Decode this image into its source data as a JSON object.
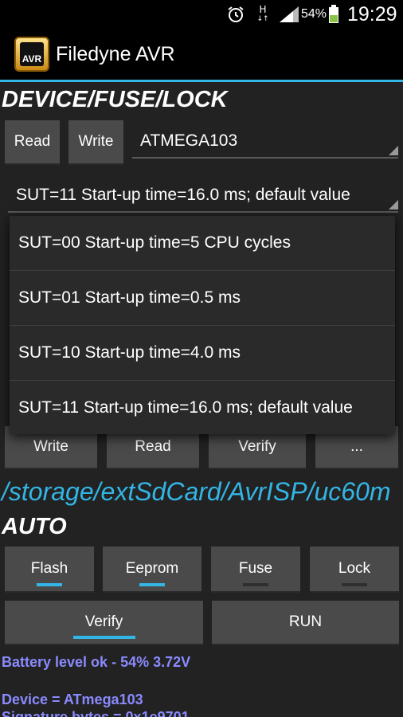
{
  "status_bar": {
    "icons": [
      "alarm-icon",
      "hspa-data-icon",
      "signal-icon",
      "battery-icon"
    ],
    "h_label": "H",
    "battery_percent": "54%",
    "time": "19:29"
  },
  "app_bar": {
    "title": "Filedyne AVR",
    "logo_text": "AVR",
    "accent_color": "#33b5e5"
  },
  "device_section": {
    "title": "DEVICE/FUSE/LOCK",
    "read_label": "Read",
    "write_label": "Write",
    "device_value": "ATMEGA103",
    "fuse_value": "SUT=11 Start-up time=16.0 ms; default value"
  },
  "file_section": {
    "buttons": [
      "Write",
      "Read",
      "Verify",
      "..."
    ],
    "path": "/storage/extSdCard/AvrISP/uc60m"
  },
  "auto_section": {
    "title": "AUTO",
    "toggles": [
      {
        "label": "Flash",
        "on": true
      },
      {
        "label": "Eeprom",
        "on": true
      },
      {
        "label": "Fuse",
        "on": false
      },
      {
        "label": "Lock",
        "on": false
      }
    ],
    "verify": {
      "label": "Verify",
      "on": true
    },
    "run_label": "RUN"
  },
  "log": {
    "battery": "Battery level ok - 54% 3.72V",
    "device": "Device = ATmega103",
    "signature": "Signature bytes = 0x1e9701",
    "color": "#8a8aff"
  },
  "dropdown": {
    "options": [
      "SUT=00 Start-up time=5 CPU cycles",
      "SUT=01 Start-up time=0.5 ms",
      "SUT=10 Start-up time=4.0 ms",
      "SUT=11 Start-up time=16.0 ms; default value"
    ]
  }
}
